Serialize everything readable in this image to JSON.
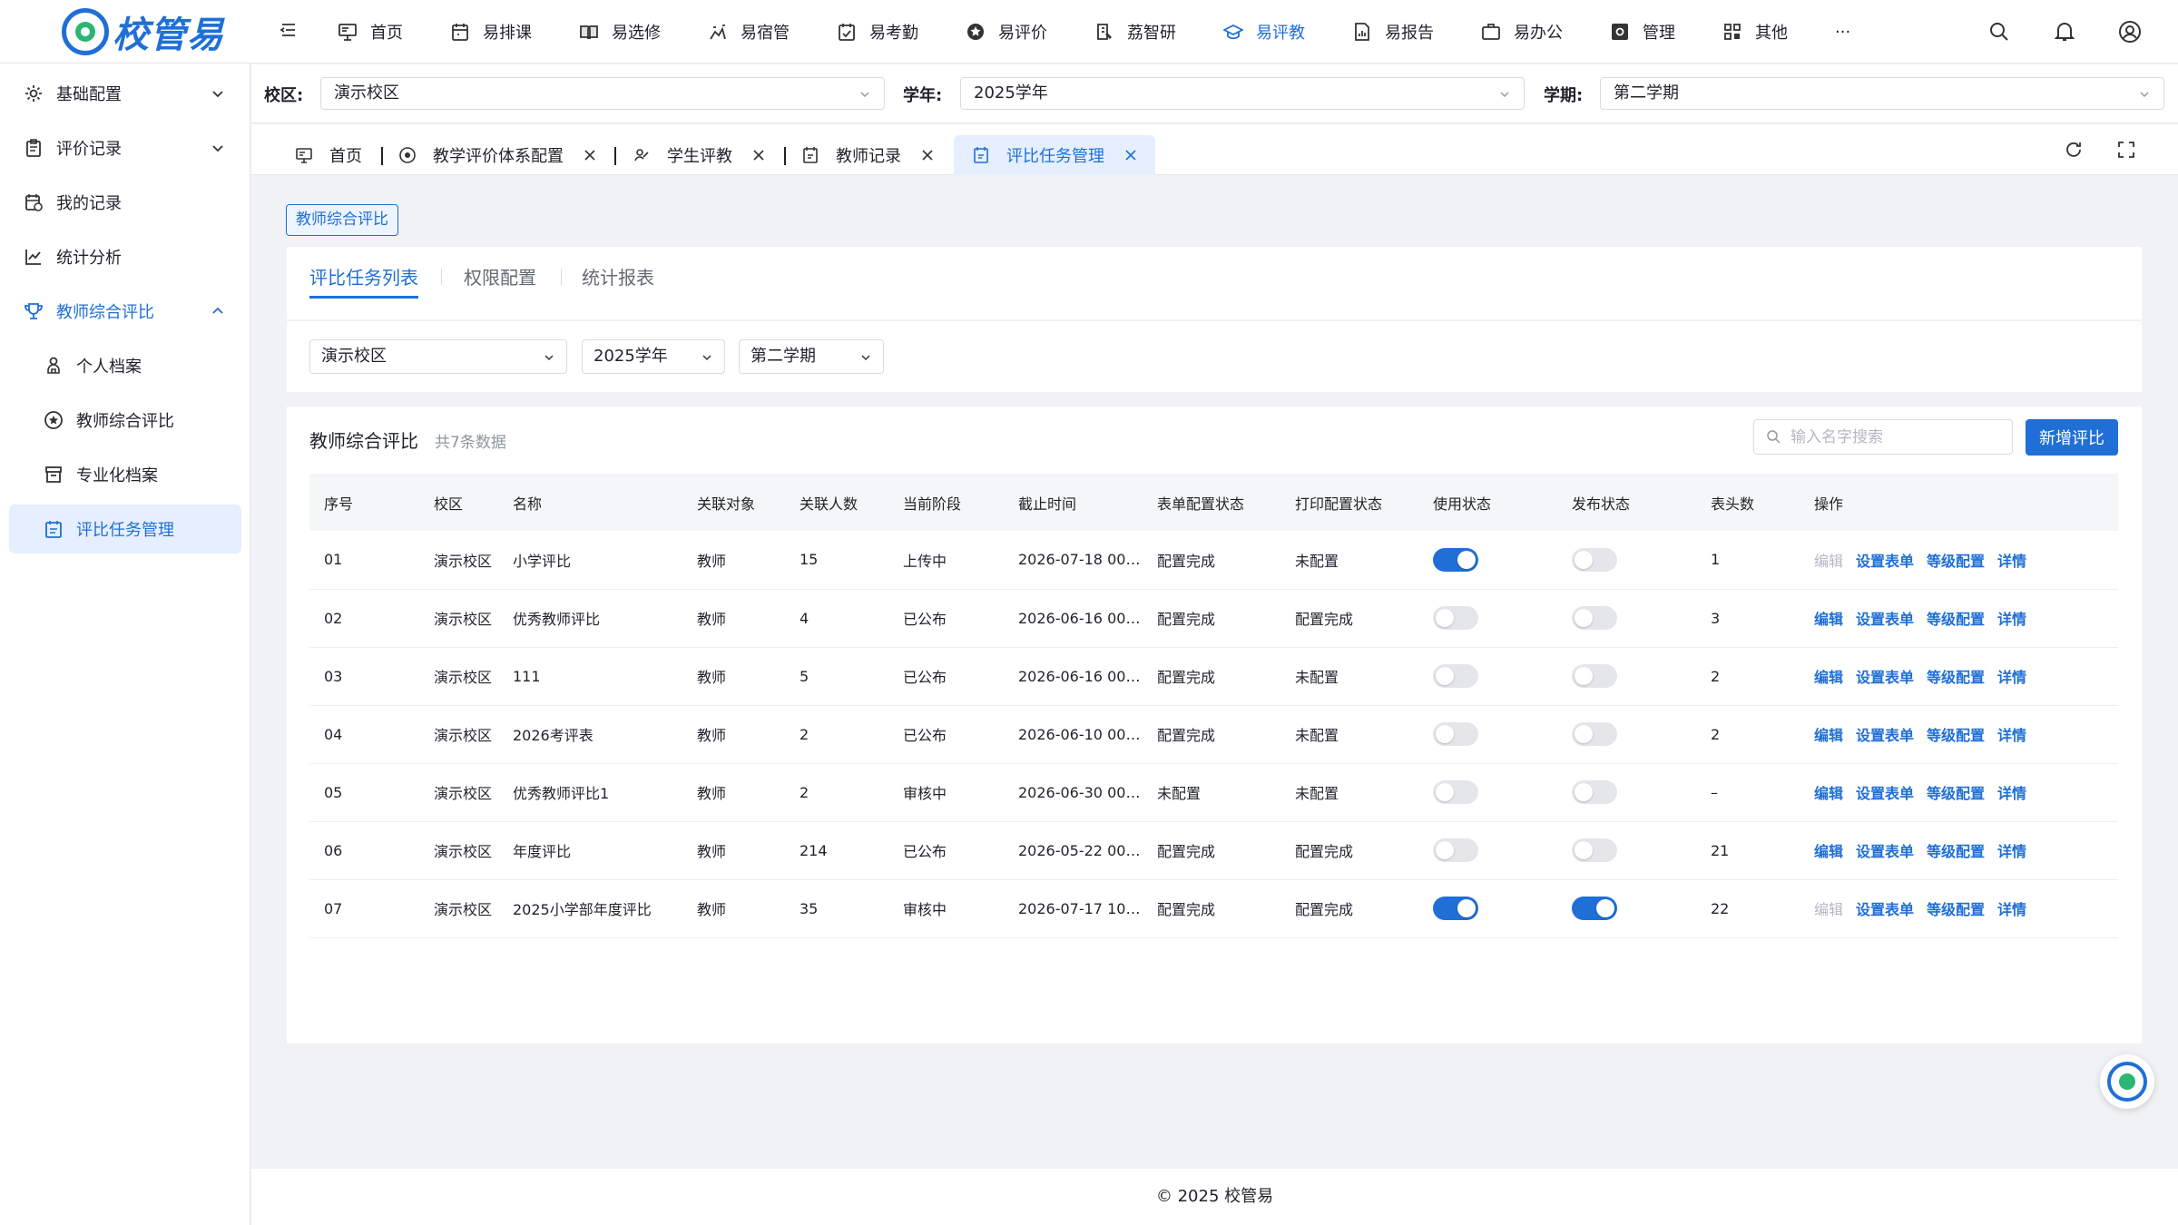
{
  "app": {
    "logo_text": "校管易",
    "accent": "#1f6fd6"
  },
  "topnav": {
    "items": [
      {
        "label": "首页",
        "icon": "monitor-icon"
      },
      {
        "label": "易排课",
        "icon": "calendar-icon"
      },
      {
        "label": "易选修",
        "icon": "book-icon"
      },
      {
        "label": "易宿管",
        "icon": "bed-icon"
      },
      {
        "label": "易考勤",
        "icon": "checklist-icon"
      },
      {
        "label": "易评价",
        "icon": "star-icon"
      },
      {
        "label": "荔智研",
        "icon": "research-icon"
      },
      {
        "label": "易评教",
        "icon": "graduation-cap-icon",
        "active": true
      },
      {
        "label": "易报告",
        "icon": "report-icon"
      },
      {
        "label": "易办公",
        "icon": "briefcase-icon"
      },
      {
        "label": "管理",
        "icon": "settings-box-icon"
      },
      {
        "label": "其他",
        "icon": "apps-icon"
      },
      {
        "label": "···",
        "icon": "more-icon"
      }
    ]
  },
  "sidebar": {
    "items": [
      {
        "label": "基础配置",
        "icon": "gear-icon"
      },
      {
        "label": "评价记录",
        "icon": "clipboard-icon"
      },
      {
        "label": "我的记录",
        "icon": "calendar-record-icon"
      },
      {
        "label": "统计分析",
        "icon": "line-chart-icon"
      },
      {
        "label": "教师综合评比",
        "icon": "trophy-icon"
      },
      {
        "label": "个人档案",
        "icon": "person-icon"
      },
      {
        "label": "教师综合评比",
        "icon": "star-circle-icon"
      },
      {
        "label": "专业化档案",
        "icon": "archive-icon"
      },
      {
        "label": "评比任务管理",
        "icon": "task-list-icon"
      }
    ]
  },
  "filterbar": {
    "campus_label": "校区:",
    "campus_value": "演示校区",
    "year_label": "学年:",
    "year_value": "2025学年",
    "term_label": "学期:",
    "term_value": "第二学期"
  },
  "tabs": [
    {
      "label": "首页",
      "icon": "monitor-icon"
    },
    {
      "label": "教学评价体系配置",
      "icon": "target-icon"
    },
    {
      "label": "学生评教",
      "icon": "student-icon"
    },
    {
      "label": "教师记录",
      "icon": "teacher-record-icon"
    },
    {
      "label": "评比任务管理",
      "icon": "task-list-icon"
    }
  ],
  "page": {
    "badge": "教师综合评比",
    "subtabs": [
      "评比任务列表",
      "权限配置",
      "统计报表"
    ],
    "filters": {
      "campus": "演示校区",
      "year": "2025学年",
      "term": "第二学期"
    },
    "table_title": "教师综合评比",
    "table_count": "共7条数据",
    "search_placeholder": "输入名字搜索",
    "add_button": "新增评比",
    "columns": [
      "序号",
      "校区",
      "名称",
      "关联对象",
      "关联人数",
      "当前阶段",
      "截止时间",
      "表单配置状态",
      "打印配置状态",
      "使用状态",
      "发布状态",
      "表头数",
      "操作"
    ],
    "op_labels": {
      "edit": "编辑",
      "form": "设置表单",
      "grade": "等级配置",
      "detail": "详情"
    },
    "rows": [
      {
        "no": "01",
        "campus": "演示校区",
        "name": "小学评比",
        "target": "教师",
        "count": "15",
        "stage": "上传中",
        "deadline": "2026-07-18 00:...",
        "form_status": "配置完成",
        "print_status": "未配置",
        "in_use": true,
        "published": false,
        "headers": "1",
        "edit_disabled": true
      },
      {
        "no": "02",
        "campus": "演示校区",
        "name": "优秀教师评比",
        "target": "教师",
        "count": "4",
        "stage": "已公布",
        "deadline": "2026-06-16 00:...",
        "form_status": "配置完成",
        "print_status": "配置完成",
        "in_use": false,
        "published": false,
        "headers": "3",
        "edit_disabled": false
      },
      {
        "no": "03",
        "campus": "演示校区",
        "name": "111",
        "target": "教师",
        "count": "5",
        "stage": "已公布",
        "deadline": "2026-06-16 00:...",
        "form_status": "配置完成",
        "print_status": "未配置",
        "in_use": false,
        "published": false,
        "headers": "2",
        "edit_disabled": false
      },
      {
        "no": "04",
        "campus": "演示校区",
        "name": "2026考评表",
        "target": "教师",
        "count": "2",
        "stage": "已公布",
        "deadline": "2026-06-10 00:...",
        "form_status": "配置完成",
        "print_status": "未配置",
        "in_use": false,
        "published": false,
        "headers": "2",
        "edit_disabled": false
      },
      {
        "no": "05",
        "campus": "演示校区",
        "name": "优秀教师评比1",
        "target": "教师",
        "count": "2",
        "stage": "审核中",
        "deadline": "2026-06-30 00:...",
        "form_status": "未配置",
        "print_status": "未配置",
        "in_use": false,
        "published": false,
        "headers": "–",
        "edit_disabled": false
      },
      {
        "no": "06",
        "campus": "演示校区",
        "name": "年度评比",
        "target": "教师",
        "count": "214",
        "stage": "已公布",
        "deadline": "2026-05-22 00:...",
        "form_status": "配置完成",
        "print_status": "配置完成",
        "in_use": false,
        "published": false,
        "headers": "21",
        "edit_disabled": false
      },
      {
        "no": "07",
        "campus": "演示校区",
        "name": "2025小学部年度评比",
        "target": "教师",
        "count": "35",
        "stage": "审核中",
        "deadline": "2026-07-17 10:...",
        "form_status": "配置完成",
        "print_status": "配置完成",
        "in_use": true,
        "published": true,
        "headers": "22",
        "edit_disabled": true
      }
    ]
  },
  "footer": "© 2025 校管易"
}
